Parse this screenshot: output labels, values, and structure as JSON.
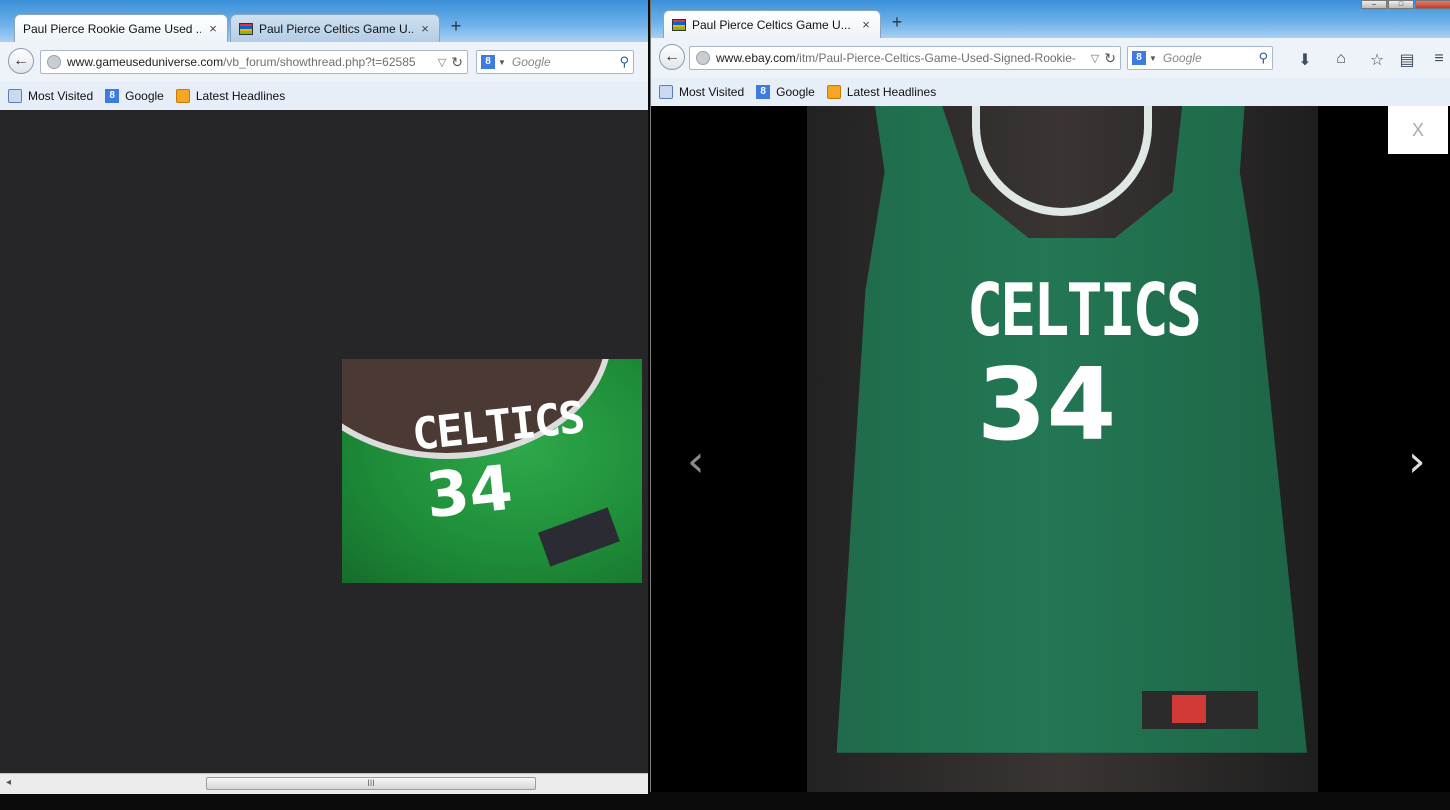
{
  "left_window": {
    "tabs": [
      {
        "title": "Paul Pierce Rookie Game Used ...",
        "selected": true
      },
      {
        "title": "Paul Pierce Celtics Game U...",
        "selected": false
      }
    ],
    "url_domain": "www.gameuseduniverse.com",
    "url_path": "/vb_forum/showthread.php?t=62585",
    "search_placeholder": "Google",
    "bookmarks": [
      "Most Visited",
      "Google",
      "Latest Headlines"
    ],
    "image": {
      "word": "CELTICS",
      "number": "34"
    }
  },
  "right_window": {
    "tabs": [
      {
        "title": "Paul Pierce Celtics Game U...",
        "selected": true
      }
    ],
    "url_domain": "www.ebay.com",
    "url_path": "/itm/Paul-Pierce-Celtics-Game-Used-Signed-Rookie-",
    "search_placeholder": "Google",
    "bookmarks": [
      "Most Visited",
      "Google",
      "Latest Headlines"
    ],
    "viewer": {
      "word": "CELTICS",
      "number": "34",
      "close_label": "X",
      "prev_glyph": "‹",
      "next_glyph": "›"
    }
  },
  "glyphs": {
    "close": "×",
    "new_tab": "+",
    "back": "←",
    "reload": "↻",
    "dropdown": "▽",
    "search": "⚲",
    "scroll_grip": "III",
    "scroll_left": "◂",
    "g": "8"
  },
  "colors": {
    "tabstrip": "#3a8fd8",
    "jersey_green": "#1d8b38",
    "jersey_teal": "#237754"
  }
}
